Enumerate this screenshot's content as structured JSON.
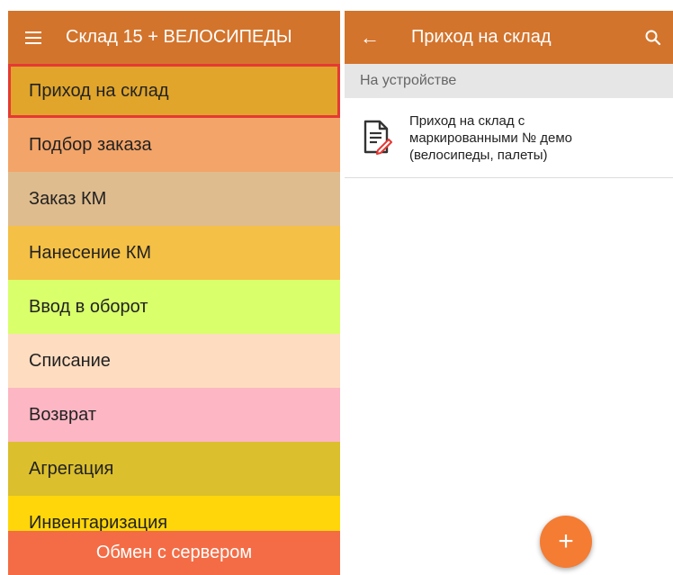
{
  "left": {
    "title": "Склад 15 + ВЕЛОСИПЕДЫ",
    "menu": [
      {
        "label": "Приход на склад",
        "color": "#e0a52a",
        "selected": true
      },
      {
        "label": "Подбор заказа",
        "color": "#f3a468"
      },
      {
        "label": "Заказ КМ",
        "color": "#dfbc8e"
      },
      {
        "label": "Нанесение КМ",
        "color": "#f4c045"
      },
      {
        "label": "Ввод в оборот",
        "color": "#d9ff6b"
      },
      {
        "label": "Списание",
        "color": "#fedcc0"
      },
      {
        "label": "Возврат",
        "color": "#fdb6c3"
      },
      {
        "label": "Агрегация",
        "color": "#dbbf2c"
      },
      {
        "label": "Инвентаризация",
        "color": "#ffd60a"
      }
    ],
    "bottom_button": "Обмен с сервером"
  },
  "right": {
    "title": "Приход на склад",
    "section_header": "На устройстве",
    "documents": [
      {
        "text": "Приход на склад с\nмаркированными № демо\n(велосипеды, палеты)",
        "icon": "document-edit-icon"
      }
    ],
    "fab_label": "+"
  },
  "colors": {
    "appbar": "#d3742c",
    "accent": "#f47c33",
    "highlight": "#e53935"
  }
}
